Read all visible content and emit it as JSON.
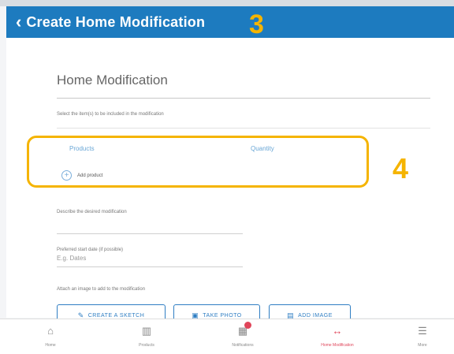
{
  "header": {
    "back_icon": "chevron-left-icon",
    "title": "Create Home Modification",
    "color": "#1d7bbf"
  },
  "annotations": {
    "step_3": "3",
    "step_4": "4",
    "color": "#f5b400"
  },
  "form": {
    "section_title": "Home Modification",
    "select_instruction": "Select the item(s) to be included in the modification",
    "products_table": {
      "columns": [
        "Products",
        "Quantity"
      ],
      "add_label": "Add product",
      "add_icon": "plus-circle-icon"
    },
    "describe_label": "Describe the desired modification",
    "preferred_label": "Preferred start date (if possible)",
    "preferred_value": "E.g. Dates",
    "attach_label": "Attach an image to add to the modification",
    "buttons": {
      "sketch": "CREATE A SKETCH",
      "photo": "TAKE PHOTO",
      "image": "ADD IMAGE"
    }
  },
  "bottom_nav": {
    "items": [
      {
        "icon": "home-icon",
        "label": "Home"
      },
      {
        "icon": "products-icon",
        "label": "Products"
      },
      {
        "icon": "notifications-icon",
        "label": "Notifications"
      },
      {
        "icon": "home-modification-icon",
        "label": "Home Modification"
      },
      {
        "icon": "more-icon",
        "label": "More"
      }
    ],
    "active_color": "#e0455a"
  }
}
